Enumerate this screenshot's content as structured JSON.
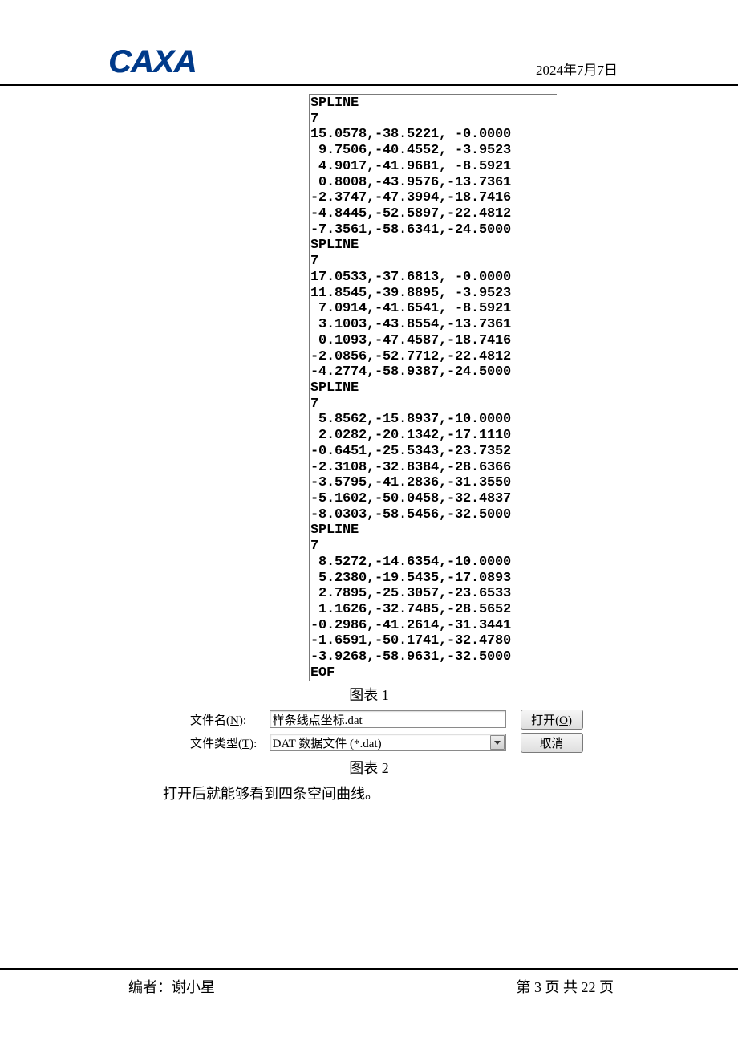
{
  "header": {
    "logo": "CAXA",
    "date": "2024年7月7日"
  },
  "file_content": "SPLINE\n7\n15.0578,-38.5221, -0.0000\n 9.7506,-40.4552, -3.9523\n 4.9017,-41.9681, -8.5921\n 0.8008,-43.9576,-13.7361\n-2.3747,-47.3994,-18.7416\n-4.8445,-52.5897,-22.4812\n-7.3561,-58.6341,-24.5000\nSPLINE\n7\n17.0533,-37.6813, -0.0000\n11.8545,-39.8895, -3.9523\n 7.0914,-41.6541, -8.5921\n 3.1003,-43.8554,-13.7361\n 0.1093,-47.4587,-18.7416\n-2.0856,-52.7712,-22.4812\n-4.2774,-58.9387,-24.5000\nSPLINE\n7\n 5.8562,-15.8937,-10.0000\n 2.0282,-20.1342,-17.1110\n-0.6451,-25.5343,-23.7352\n-2.3108,-32.8384,-28.6366\n-3.5795,-41.2836,-31.3550\n-5.1602,-50.0458,-32.4837\n-8.0303,-58.5456,-32.5000\nSPLINE\n7\n 8.5272,-14.6354,-10.0000\n 5.2380,-19.5435,-17.0893\n 2.7895,-25.3057,-23.6533\n 1.1626,-32.7485,-28.5652\n-0.2986,-41.2614,-31.3441\n-1.6591,-50.1741,-32.4780\n-3.9268,-58.9631,-32.5000\nEOF",
  "caption1": "图表 1",
  "dialog": {
    "row1": {
      "label_prefix": "文件名(",
      "label_underline": "N",
      "label_suffix": "):",
      "input_value": "样条线点坐标.dat",
      "button_prefix": "打开(",
      "button_underline": "O",
      "button_suffix": ")"
    },
    "row2": {
      "label_prefix": "文件类型(",
      "label_underline": "T",
      "label_suffix": "):",
      "select_value": "DAT 数据文件 (*.dat)",
      "button": "取消"
    }
  },
  "caption2": "图表 2",
  "body_paragraph": "打开后就能够看到四条空间曲线。",
  "footer": {
    "author": "编者：谢小星",
    "pagination": "第 3 页 共 22 页"
  }
}
